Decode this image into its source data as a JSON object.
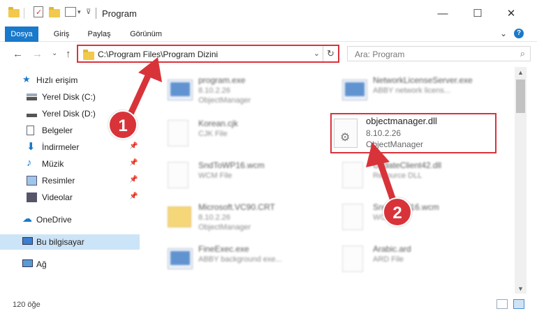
{
  "window": {
    "title": "Program",
    "minimize": "—",
    "maximize": "☐",
    "close": "✕"
  },
  "ribbon": {
    "tabs": [
      {
        "label": "Dosya",
        "active": true
      },
      {
        "label": "Giriş",
        "active": false
      },
      {
        "label": "Paylaş",
        "active": false
      },
      {
        "label": "Görünüm",
        "active": false
      }
    ],
    "expand_icon": "⌄",
    "help_icon": "?"
  },
  "nav": {
    "back": "←",
    "forward": "→",
    "recent": "⌄",
    "up": "↑",
    "address": "C:\\Program Files\\Program Dizini",
    "address_dropdown": "⌄",
    "refresh": "↻",
    "search_placeholder": "Ara: Program",
    "search_icon": "⌕"
  },
  "sidebar": {
    "quick_access": "Hızlı erişim",
    "items": [
      {
        "label": "Yerel Disk (C:)",
        "icon": "drive-icon",
        "pinned": false
      },
      {
        "label": "Yerel Disk (D:)",
        "icon": "drive-icon",
        "pinned": false
      },
      {
        "label": "Belgeler",
        "icon": "documents-icon",
        "pinned": false
      },
      {
        "label": "İndirmeler",
        "icon": "downloads-icon",
        "pinned": true
      },
      {
        "label": "Müzik",
        "icon": "music-icon",
        "pinned": true
      },
      {
        "label": "Resimler",
        "icon": "pictures-icon",
        "pinned": true
      },
      {
        "label": "Videolar",
        "icon": "videos-icon",
        "pinned": true
      }
    ],
    "onedrive": "OneDrive",
    "this_pc": "Bu bilgisayar",
    "network": "Ağ",
    "pin_glyph": "📌"
  },
  "files": [
    {
      "name": "program.exe",
      "l2": "8.10.2.26",
      "l3": "ObjectManager",
      "kind": "app"
    },
    {
      "name": "NetworkLicenseServer.exe",
      "l2": "ABBY network licens...",
      "l3": "",
      "kind": "app"
    },
    {
      "name": "Korean.cjk",
      "l2": "CJK File",
      "l3": "",
      "kind": "doc"
    },
    {
      "name": "objectmanager.dll",
      "l2": "8.10.2.26",
      "l3": "ObjectManager",
      "kind": "dll"
    },
    {
      "name": "SndToWP16.wcm",
      "l2": "WCM File",
      "l3": "",
      "kind": "doc"
    },
    {
      "name": "UpdateClient42.dll",
      "l2": "Resource DLL",
      "l3": "",
      "kind": "doc"
    },
    {
      "name": "Microsoft.VC90.CRT",
      "l2": "8.10.2.26",
      "l3": "ObjectManager",
      "kind": "fold"
    },
    {
      "name": "SndToWP16.wcm",
      "l2": "WCM File",
      "l3": "",
      "kind": "doc"
    },
    {
      "name": "FineExec.exe",
      "l2": "ABBY background exe...",
      "l3": "",
      "kind": "app"
    },
    {
      "name": "Arabic.ard",
      "l2": "ARD File",
      "l3": "",
      "kind": "doc"
    }
  ],
  "status": {
    "count": "120 öğe"
  },
  "annotations": {
    "step1": "1",
    "step2": "2"
  },
  "colors": {
    "accent": "#1979ca",
    "highlight": "#d9333a",
    "selection": "#cce4f7"
  }
}
